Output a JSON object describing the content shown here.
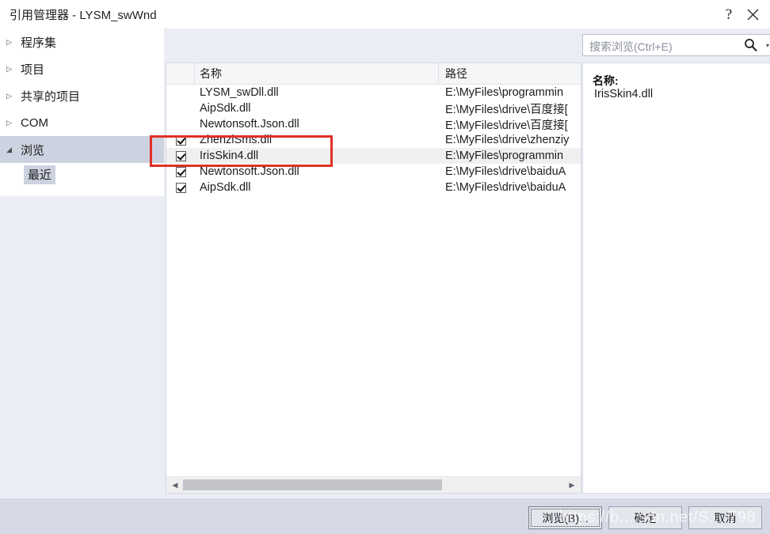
{
  "window": {
    "title": "引用管理器 - LYSM_swWnd",
    "help_glyph": "?",
    "close_glyph": "✕"
  },
  "sidebar": {
    "items": [
      {
        "label": "程序集",
        "arrow": "▷",
        "expanded": false,
        "selected": false
      },
      {
        "label": "项目",
        "arrow": "▷",
        "expanded": false,
        "selected": false
      },
      {
        "label": "共享的项目",
        "arrow": "▷",
        "expanded": false,
        "selected": false
      },
      {
        "label": "COM",
        "arrow": "▷",
        "expanded": false,
        "selected": false
      },
      {
        "label": "浏览",
        "arrow": "◢",
        "expanded": true,
        "selected": true
      }
    ],
    "sub_item": {
      "label": "最近",
      "selected": true
    }
  },
  "search": {
    "placeholder": "搜索浏览(Ctrl+E)",
    "value": "",
    "icon": "search-icon",
    "dropdown_glyph": "▾"
  },
  "list": {
    "columns": [
      "",
      "名称",
      "路径"
    ],
    "rows": [
      {
        "checked": false,
        "has_checkbox": false,
        "name": "LYSM_swDll.dll",
        "path": "E:\\MyFiles\\programmin",
        "highlight": false
      },
      {
        "checked": false,
        "has_checkbox": false,
        "name": "AipSdk.dll",
        "path": "E:\\MyFiles\\drive\\百度接[",
        "highlight": false
      },
      {
        "checked": false,
        "has_checkbox": false,
        "name": "Newtonsoft.Json.dll",
        "path": "E:\\MyFiles\\drive\\百度接[",
        "highlight": false
      },
      {
        "checked": true,
        "has_checkbox": true,
        "name": "ZhenziSms.dll",
        "path": "E:\\MyFiles\\drive\\zhenziy",
        "highlight": false
      },
      {
        "checked": true,
        "has_checkbox": true,
        "name": "IrisSkin4.dll",
        "path": "E:\\MyFiles\\programmin",
        "highlight": true
      },
      {
        "checked": true,
        "has_checkbox": true,
        "name": "Newtonsoft.Json.dll",
        "path": "E:\\MyFiles\\drive\\baiduA",
        "highlight": false
      },
      {
        "checked": true,
        "has_checkbox": true,
        "name": "AipSdk.dll",
        "path": "E:\\MyFiles\\drive\\baiduA",
        "highlight": false
      }
    ],
    "scrollbar": {
      "left_arrow": "◀",
      "right_arrow": "▶"
    }
  },
  "details": {
    "label": "名称:",
    "value": "IrisSkin4.dll"
  },
  "footer": {
    "browse_label": "浏览(B)...",
    "browse_accel": "B",
    "ok_label": "确定",
    "cancel_label": "取消"
  },
  "annotation": {
    "color": "#e03127",
    "target_row": "IrisSkin4.dll"
  },
  "watermark": {
    "text": "https://b....sdn.net/S....798"
  }
}
